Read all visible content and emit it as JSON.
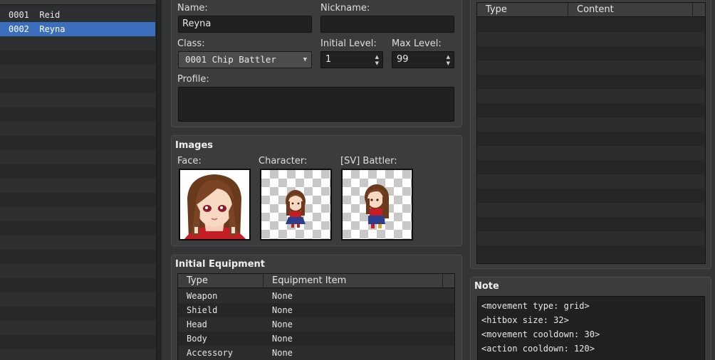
{
  "actor_list": {
    "items": [
      {
        "label": "0001  Reid",
        "selected": false
      },
      {
        "label": "0002  Reyna",
        "selected": true
      }
    ]
  },
  "general": {
    "name_label": "Name:",
    "name_value": "Reyna",
    "nickname_label": "Nickname:",
    "nickname_value": "",
    "class_label": "Class:",
    "class_value": "0001 Chip Battler",
    "initial_level_label": "Initial Level:",
    "initial_level_value": "1",
    "max_level_label": "Max Level:",
    "max_level_value": "99",
    "profile_label": "Profile:",
    "profile_value": ""
  },
  "images": {
    "title": "Images",
    "face_label": "Face:",
    "character_label": "Character:",
    "battler_label": "[SV] Battler:"
  },
  "equipment": {
    "title": "Initial Equipment",
    "columns": [
      "Type",
      "Equipment Item"
    ],
    "rows": [
      {
        "type": "Weapon",
        "item": "None"
      },
      {
        "type": "Shield",
        "item": "None"
      },
      {
        "type": "Head",
        "item": "None"
      },
      {
        "type": "Body",
        "item": "None"
      },
      {
        "type": "Accessory",
        "item": "None"
      }
    ]
  },
  "traits": {
    "columns": [
      "Type",
      "Content"
    ]
  },
  "note": {
    "title": "Note",
    "lines": [
      "<movement type: grid>",
      "<hitbox size: 32>",
      "<movement cooldown: 30>",
      "<action cooldown: 120>"
    ]
  },
  "colors": {
    "selection": "#3b6fbd",
    "panel": "#3a3c3e",
    "field": "#1f2122"
  }
}
